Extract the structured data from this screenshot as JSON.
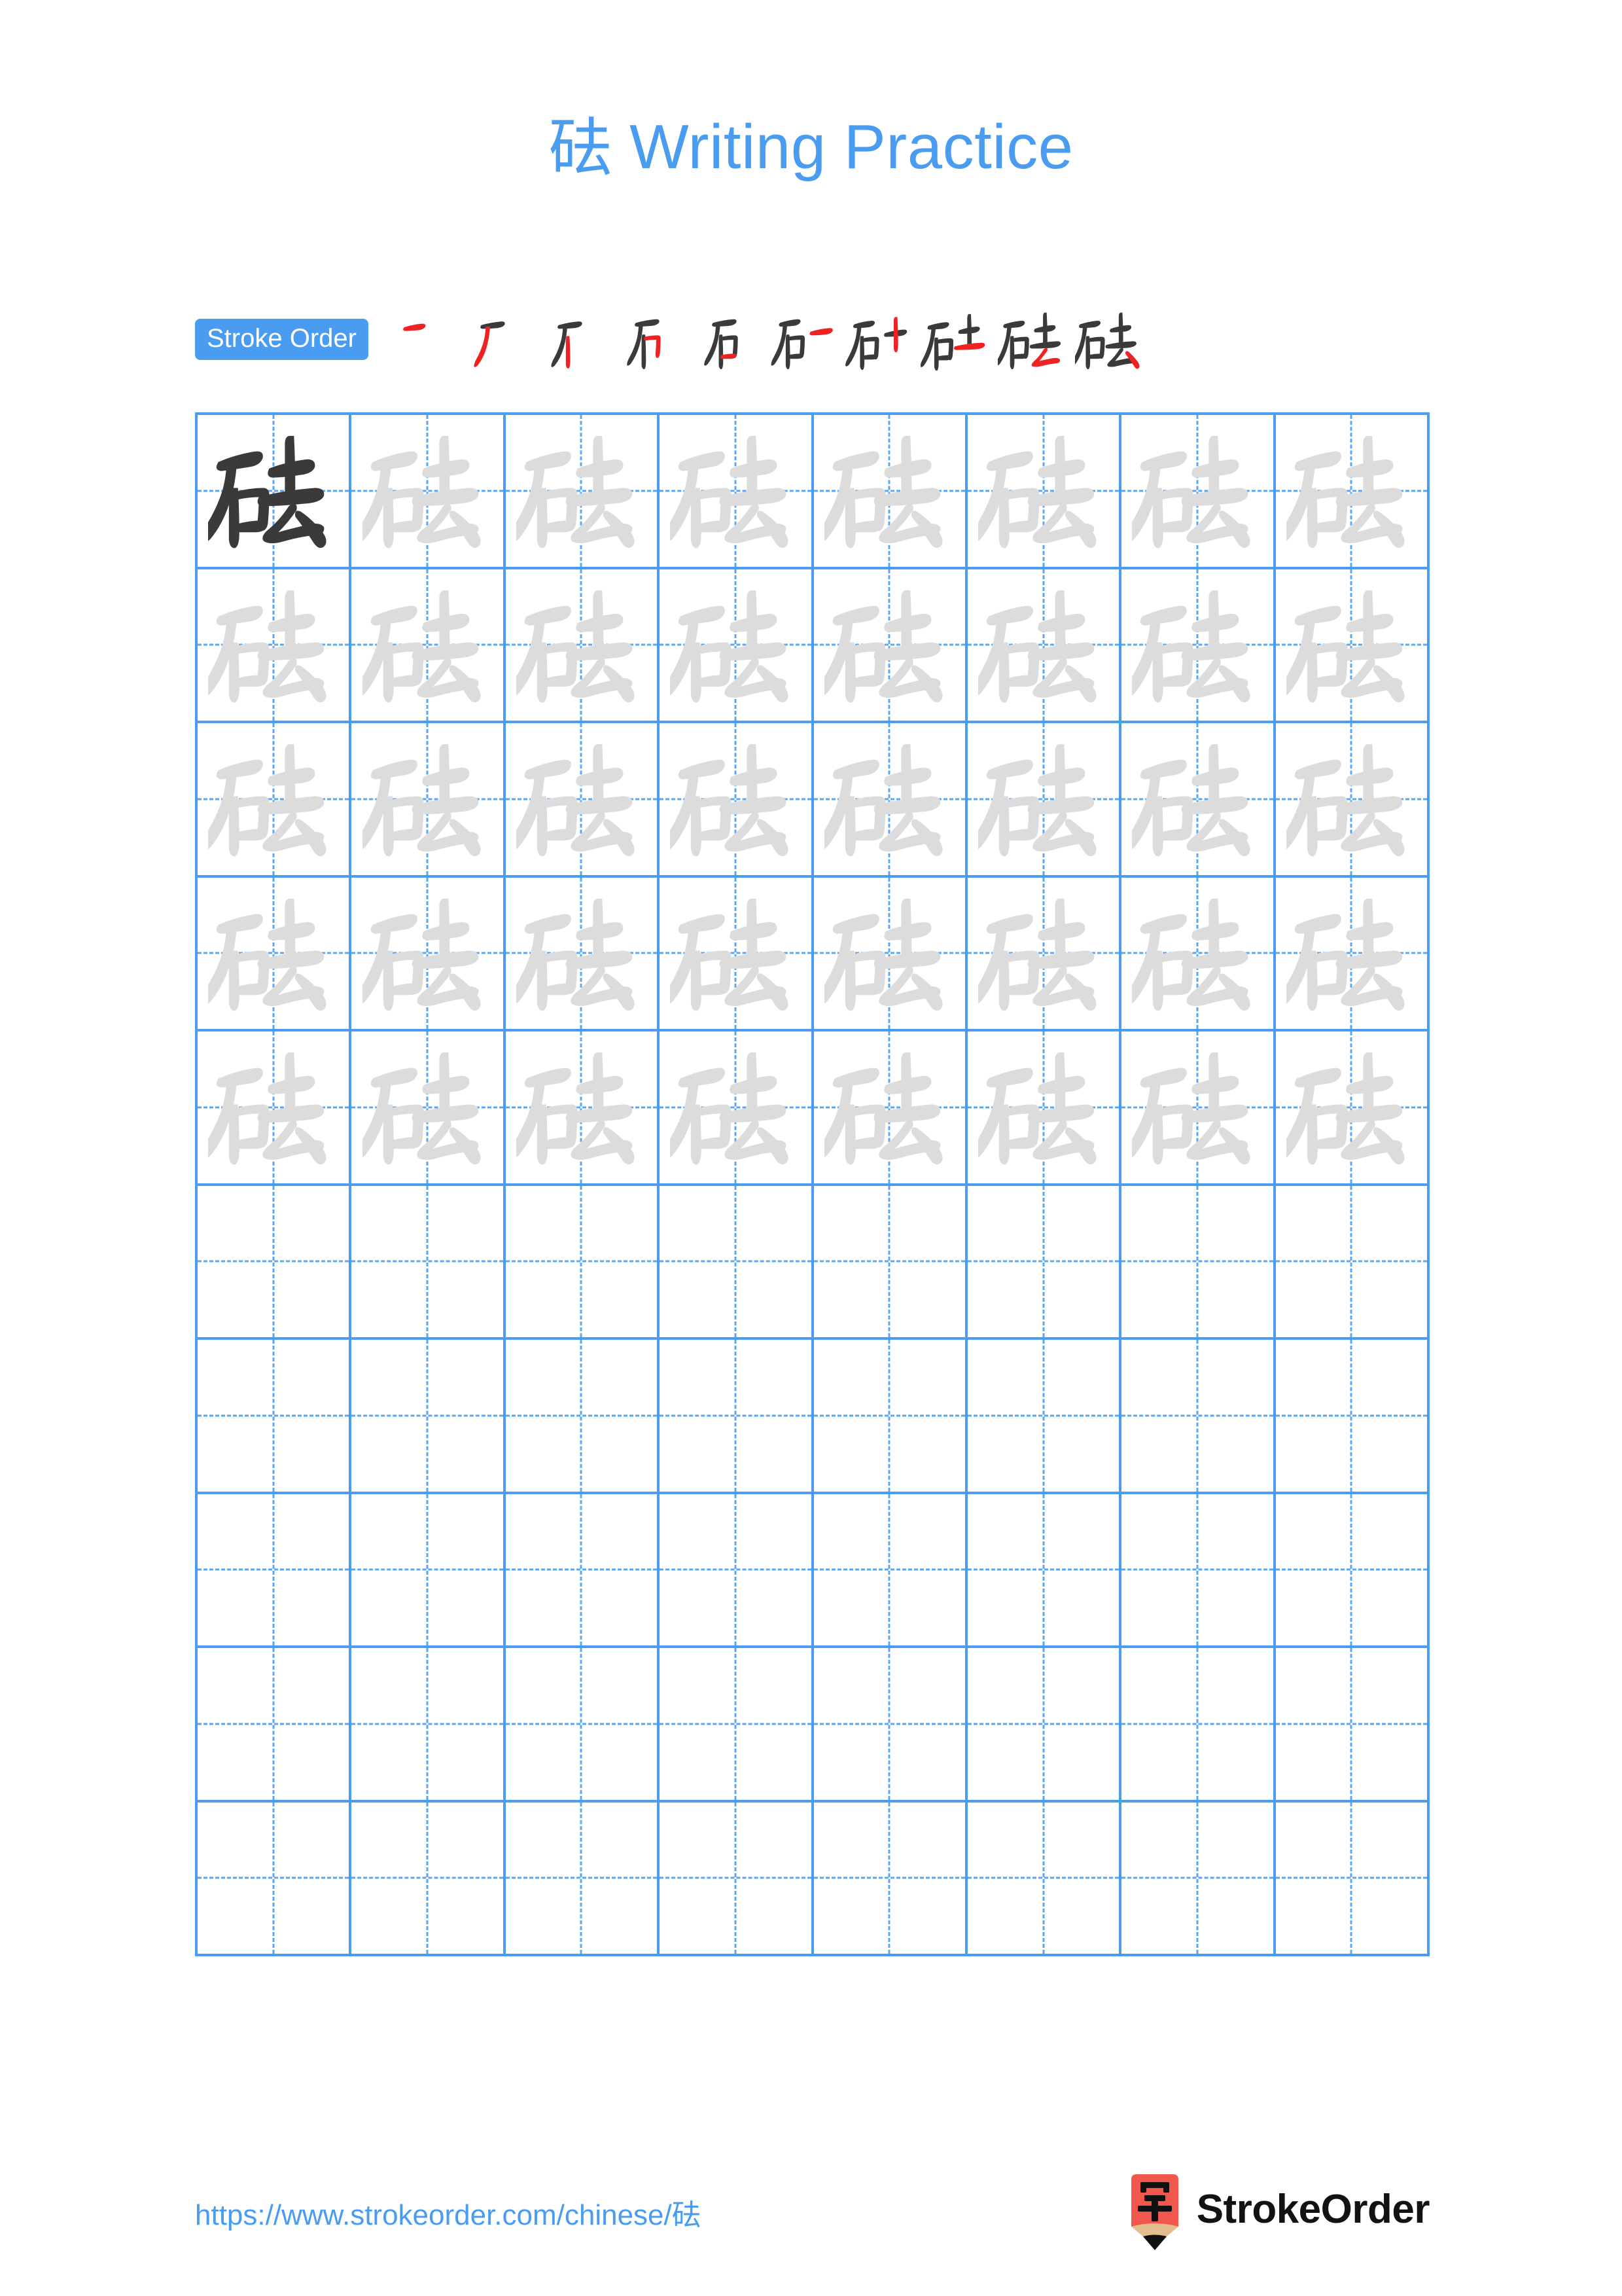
{
  "page": {
    "background": "#ffffff",
    "accent_blue": "#4a9cf0",
    "grid_line_blue": "#4a9cf0",
    "dashed_blue": "#5aa7f2",
    "ink_dark": "#3a3a3a",
    "ink_light": "#dcdcdc",
    "stroke_highlight_red": "#ee2222",
    "logo_red": "#f2574d",
    "logo_wood": "#e3bd8e"
  },
  "header": {
    "character": "砝",
    "title_suffix": " Writing Practice",
    "title_full": "砝 Writing Practice"
  },
  "stroke_order": {
    "badge_label": "Stroke Order",
    "total_strokes": 10,
    "character": "砝",
    "steps": [
      {
        "index": 1,
        "new_stroke": "横 (héng)",
        "cumulative": "一"
      },
      {
        "index": 2,
        "new_stroke": "撇 (piě)",
        "cumulative": "丆"
      },
      {
        "index": 3,
        "new_stroke": "竖 (shù)",
        "cumulative": "丆丨"
      },
      {
        "index": 4,
        "new_stroke": "横折 (héng zhé)",
        "cumulative": "石(部分)"
      },
      {
        "index": 5,
        "new_stroke": "横 (héng)",
        "cumulative": "石"
      },
      {
        "index": 6,
        "new_stroke": "横 (héng)",
        "cumulative": "石一"
      },
      {
        "index": 7,
        "new_stroke": "竖 (shù)",
        "cumulative": "石十"
      },
      {
        "index": 8,
        "new_stroke": "横 (héng)",
        "cumulative": "石土"
      },
      {
        "index": 9,
        "new_stroke": "撇折 (piě zhé)",
        "cumulative": "砝(部分)"
      },
      {
        "index": 10,
        "new_stroke": "点 (diǎn)",
        "cumulative": "砝"
      }
    ]
  },
  "practice_grid": {
    "columns": 8,
    "rows": 10,
    "filled_rows": 5,
    "empty_rows": 5,
    "first_cell_style": "dark-model",
    "trace_style": "light-gray",
    "cells": [
      [
        "dark",
        "light",
        "light",
        "light",
        "light",
        "light",
        "light",
        "light"
      ],
      [
        "light",
        "light",
        "light",
        "light",
        "light",
        "light",
        "light",
        "light"
      ],
      [
        "light",
        "light",
        "light",
        "light",
        "light",
        "light",
        "light",
        "light"
      ],
      [
        "light",
        "light",
        "light",
        "light",
        "light",
        "light",
        "light",
        "light"
      ],
      [
        "light",
        "light",
        "light",
        "light",
        "light",
        "light",
        "light",
        "light"
      ],
      [
        "empty",
        "empty",
        "empty",
        "empty",
        "empty",
        "empty",
        "empty",
        "empty"
      ],
      [
        "empty",
        "empty",
        "empty",
        "empty",
        "empty",
        "empty",
        "empty",
        "empty"
      ],
      [
        "empty",
        "empty",
        "empty",
        "empty",
        "empty",
        "empty",
        "empty",
        "empty"
      ],
      [
        "empty",
        "empty",
        "empty",
        "empty",
        "empty",
        "empty",
        "empty",
        "empty"
      ],
      [
        "empty",
        "empty",
        "empty",
        "empty",
        "empty",
        "empty",
        "empty",
        "empty"
      ]
    ]
  },
  "footer": {
    "url": "https://www.strokeorder.com/chinese/砝",
    "brand_name": "StrokeOrder",
    "logo_character": "字"
  }
}
